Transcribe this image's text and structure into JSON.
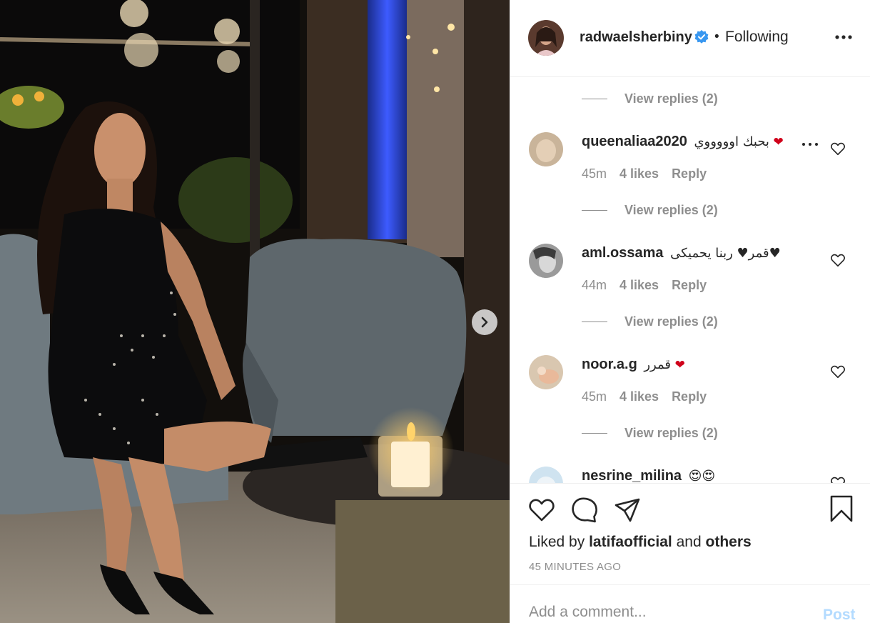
{
  "post": {
    "username": "radwaelsherbiny",
    "separator": "•",
    "follow_status": "Following",
    "verified": true
  },
  "comments": [
    {
      "username": "queenaliaa2020",
      "text": "بحبك اوووووي",
      "emoji": "❤",
      "age": "45m",
      "likes": "4 likes",
      "reply_label": "Reply",
      "view_replies": "View replies (2)"
    },
    {
      "username": "aml.ossama",
      "text": "قمر♥ ربنا يحميكى♥",
      "emoji": "",
      "age": "44m",
      "likes": "4 likes",
      "reply_label": "Reply",
      "view_replies": "View replies (2)"
    },
    {
      "username": "noor.a.g",
      "text": "قمرر",
      "emoji": "❤",
      "age": "45m",
      "likes": "4 likes",
      "reply_label": "Reply",
      "view_replies": "View replies (2)"
    },
    {
      "username": "nesrine_milina",
      "text": "😍😍",
      "emoji": "",
      "age": "",
      "likes": "",
      "reply_label": "",
      "view_replies": ""
    }
  ],
  "top_view_replies": "View replies (2)",
  "footer": {
    "liked_by_prefix": "Liked by",
    "liked_by_user": "latifaofficial",
    "liked_by_and": "and",
    "liked_by_others": "others",
    "timestamp": "45 MINUTES AGO"
  },
  "add_comment": {
    "placeholder": "Add a comment...",
    "post_label": "Post"
  },
  "icons": {
    "next": "chevron-right-icon",
    "more": "more-horizontal-icon",
    "like": "heart-outline-icon",
    "comment": "comment-bubble-icon",
    "share": "paper-plane-icon",
    "save": "bookmark-icon",
    "verified": "verified-badge-icon"
  },
  "colors": {
    "verified_blue": "#3897f0",
    "muted_text": "#8e8e8e",
    "post_disabled": "#b3dbff",
    "heart_red": "#d0021b"
  }
}
